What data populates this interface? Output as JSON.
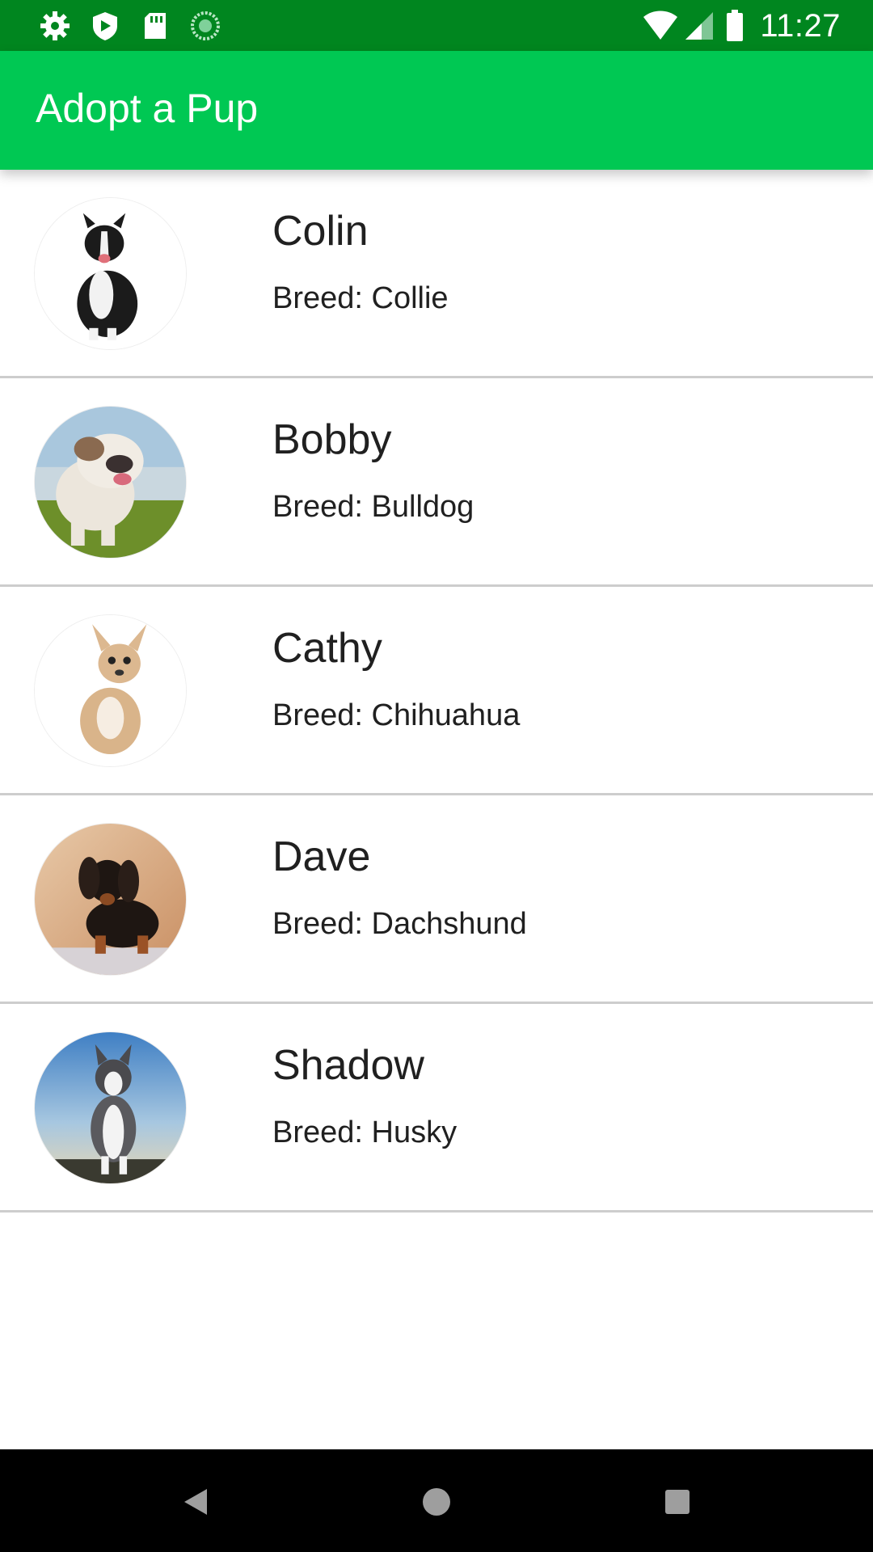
{
  "status_bar": {
    "time": "11:27",
    "left_icons": [
      "settings-icon",
      "shield-icon",
      "sd-card-icon",
      "sync-icon"
    ],
    "right_icons": [
      "wifi-icon",
      "signal-icon",
      "battery-icon"
    ]
  },
  "app_bar": {
    "title": "Adopt a Pup",
    "color": "#00c853",
    "status_color": "#00861f"
  },
  "pups": [
    {
      "name": "Colin",
      "breed": "Breed: Collie",
      "photo": "collie-photo"
    },
    {
      "name": "Bobby",
      "breed": "Breed: Bulldog",
      "photo": "bulldog-photo"
    },
    {
      "name": "Cathy",
      "breed": "Breed: Chihuahua",
      "photo": "chihuahua-photo"
    },
    {
      "name": "Dave",
      "breed": "Breed: Dachshund",
      "photo": "dachshund-photo"
    },
    {
      "name": "Shadow",
      "breed": "Breed: Husky",
      "photo": "husky-photo"
    }
  ],
  "nav_bar": {
    "buttons": [
      "back-icon",
      "home-icon",
      "recents-icon"
    ]
  }
}
